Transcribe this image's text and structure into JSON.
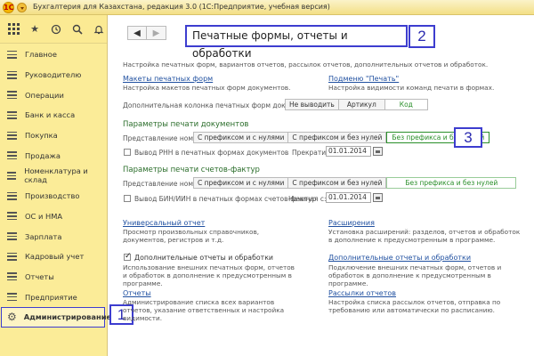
{
  "window": {
    "logo": "1С",
    "title": "Бухгалтерия для Казахстана, редакция 3.0  (1С:Предприятие, учебная версия)"
  },
  "toolbar": {
    "icons": [
      "apps-grid-icon",
      "star-icon",
      "history-icon",
      "search-icon",
      "bell-icon"
    ]
  },
  "sidebar": {
    "items": [
      {
        "label": "Главное",
        "icon": "menu-lines-icon"
      },
      {
        "label": "Руководителю",
        "icon": "menu-lines-icon"
      },
      {
        "label": "Операции",
        "icon": "menu-lines-icon"
      },
      {
        "label": "Банк и касса",
        "icon": "menu-lines-icon"
      },
      {
        "label": "Покупка",
        "icon": "menu-lines-icon"
      },
      {
        "label": "Продажа",
        "icon": "menu-lines-icon"
      },
      {
        "label": "Номенклатура и склад",
        "icon": "menu-lines-icon"
      },
      {
        "label": "Производство",
        "icon": "menu-lines-icon"
      },
      {
        "label": "ОС и НМА",
        "icon": "menu-lines-icon"
      },
      {
        "label": "Зарплата",
        "icon": "menu-lines-icon"
      },
      {
        "label": "Кадровый учет",
        "icon": "menu-lines-icon"
      },
      {
        "label": "Отчеты",
        "icon": "menu-lines-icon"
      },
      {
        "label": "Предприятие",
        "icon": "menu-lines-icon"
      },
      {
        "label": "Администрирование",
        "icon": "gear-icon",
        "active": true
      }
    ]
  },
  "annotations": {
    "a1": "1",
    "a2": "2",
    "a3": "3"
  },
  "nav": {
    "back": "◀",
    "forward": "▶"
  },
  "page": {
    "title": "Печатные формы, отчеты и обработки",
    "intro": "Настройка печатных форм, вариантов отчетов, рассылок отчетов, дополнительных отчетов и обработок.",
    "layouts_link": "Макеты печатных форм",
    "layouts_desc": "Настройка макетов печатных форм документов.",
    "print_submenu_link": "Подменю \"Печать\"",
    "print_submenu_desc": "Настройка видимости команд печати в формах.",
    "extra_column_label": "Дополнительная колонка печатных форм документов:",
    "extra_column_options": [
      "Не выводить",
      "Артикул",
      "Код"
    ],
    "doc_print_header": "Параметры печати документов",
    "number_repr_label": "Представление номера:",
    "number_repr_options": [
      "С префиксом и с нулями",
      "С префиксом и без нулей",
      "Без префикса и без нулей"
    ],
    "rnn_checkbox": "Вывод РНН в печатных формах документов",
    "stop_from_label": "Прекратить с:",
    "stop_from_date": "01.01.2014",
    "invoice_print_header": "Параметры печати счетов-фактур",
    "invoice_number_label": "Представление номера:",
    "invoice_number_options": [
      "С префиксом и с нулями",
      "С префиксом и без нулей",
      "Без префикса и без нулей"
    ],
    "bin_checkbox": "Вывод БИН/ИИН в печатных формах счетов-фактур",
    "start_from_label": "Начиная с:",
    "start_from_date": "01.01.2014",
    "universal_report_link": "Универсальный отчет",
    "universal_report_desc": "Просмотр произвольных справочников, документов, регистров и т.д.",
    "extensions_link": "Расширения",
    "extensions_desc": "Установка расширений: разделов, отчетов и обработок в дополнение к предусмотренным в программе.",
    "extra_reports_checkbox": "Дополнительные отчеты и обработки",
    "extra_reports_desc": "Использование внешних печатных форм, отчетов и обработок в дополнение к предусмотренным в программе.",
    "extra_reports_link": "Дополнительные отчеты и обработки",
    "extra_reports_link_desc": "Подключение внешних печатных форм, отчетов и обработок в дополнение к предусмотренным в программе.",
    "reports_link": "Отчеты",
    "reports_desc": "Администрирование списка всех вариантов отчетов, указание ответственных и настройка видимости.",
    "mailing_link": "Рассылки отчетов",
    "mailing_desc": "Настройка списка рассылок отчетов, отправка по требованию или автоматически по расписанию."
  },
  "colors": {
    "sidebar_bg": "#fbec98",
    "annotation_blue": "#3d3dcf",
    "header_green": "#2a6d2a",
    "link_blue": "#2050a0"
  }
}
